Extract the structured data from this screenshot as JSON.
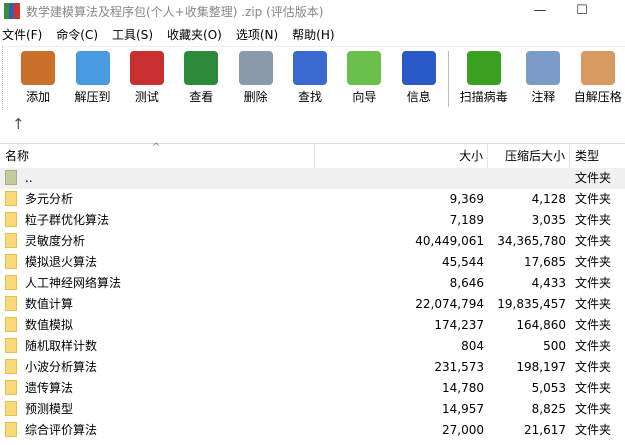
{
  "window": {
    "title": "数学建模算法及程序包(个人+收集整理) .zip (评估版本)",
    "minimize": "—",
    "maximize": "☐"
  },
  "menu": [
    "文件(F)",
    "命令(C)",
    "工具(S)",
    "收藏夹(O)",
    "选项(N)",
    "帮助(H)"
  ],
  "toolbar": [
    {
      "label": "添加",
      "icon": "add-icon",
      "color": "#c8702a"
    },
    {
      "label": "解压到",
      "icon": "extract-folder-icon",
      "color": "#4a9ae0"
    },
    {
      "label": "测试",
      "icon": "test-clipboard-icon",
      "color": "#c83030"
    },
    {
      "label": "查看",
      "icon": "view-book-icon",
      "color": "#2a8a3a"
    },
    {
      "label": "删除",
      "icon": "trash-icon",
      "color": "#8a9aaa"
    },
    {
      "label": "查找",
      "icon": "search-icon",
      "color": "#3a6ad0"
    },
    {
      "label": "向导",
      "icon": "wizard-wand-icon",
      "color": "#6ac04a"
    },
    {
      "label": "信息",
      "icon": "info-icon",
      "color": "#2a5ac8"
    },
    {
      "label": "扫描病毒",
      "icon": "virus-scan-icon",
      "color": "#3aa020"
    },
    {
      "label": "注释",
      "icon": "comment-icon",
      "color": "#7a9ac8"
    },
    {
      "label": "自解压格",
      "icon": "sfx-box-icon",
      "color": "#d89a60"
    }
  ],
  "path": {
    "up": "↑"
  },
  "columns": {
    "name": "名称",
    "size": "大小",
    "packed": "压缩后大小",
    "type": "类型",
    "sort": "^"
  },
  "rows": [
    {
      "name": "..",
      "size": "",
      "packed": "",
      "type": "文件夹"
    },
    {
      "name": "多元分析",
      "size": "9,369",
      "packed": "4,128",
      "type": "文件夹"
    },
    {
      "name": "粒子群优化算法",
      "size": "7,189",
      "packed": "3,035",
      "type": "文件夹"
    },
    {
      "name": "灵敏度分析",
      "size": "40,449,061",
      "packed": "34,365,780",
      "type": "文件夹"
    },
    {
      "name": "模拟退火算法",
      "size": "45,544",
      "packed": "17,685",
      "type": "文件夹"
    },
    {
      "name": "人工神经网络算法",
      "size": "8,646",
      "packed": "4,433",
      "type": "文件夹"
    },
    {
      "name": "数值计算",
      "size": "22,074,794",
      "packed": "19,835,457",
      "type": "文件夹"
    },
    {
      "name": "数值模拟",
      "size": "174,237",
      "packed": "164,860",
      "type": "文件夹"
    },
    {
      "name": "随机取样计数",
      "size": "804",
      "packed": "500",
      "type": "文件夹"
    },
    {
      "name": "小波分析算法",
      "size": "231,573",
      "packed": "198,197",
      "type": "文件夹"
    },
    {
      "name": "遗传算法",
      "size": "14,780",
      "packed": "5,053",
      "type": "文件夹"
    },
    {
      "name": "预测模型",
      "size": "14,957",
      "packed": "8,825",
      "type": "文件夹"
    },
    {
      "name": "综合评价算法",
      "size": "27,000",
      "packed": "21,617",
      "type": "文件夹"
    }
  ]
}
